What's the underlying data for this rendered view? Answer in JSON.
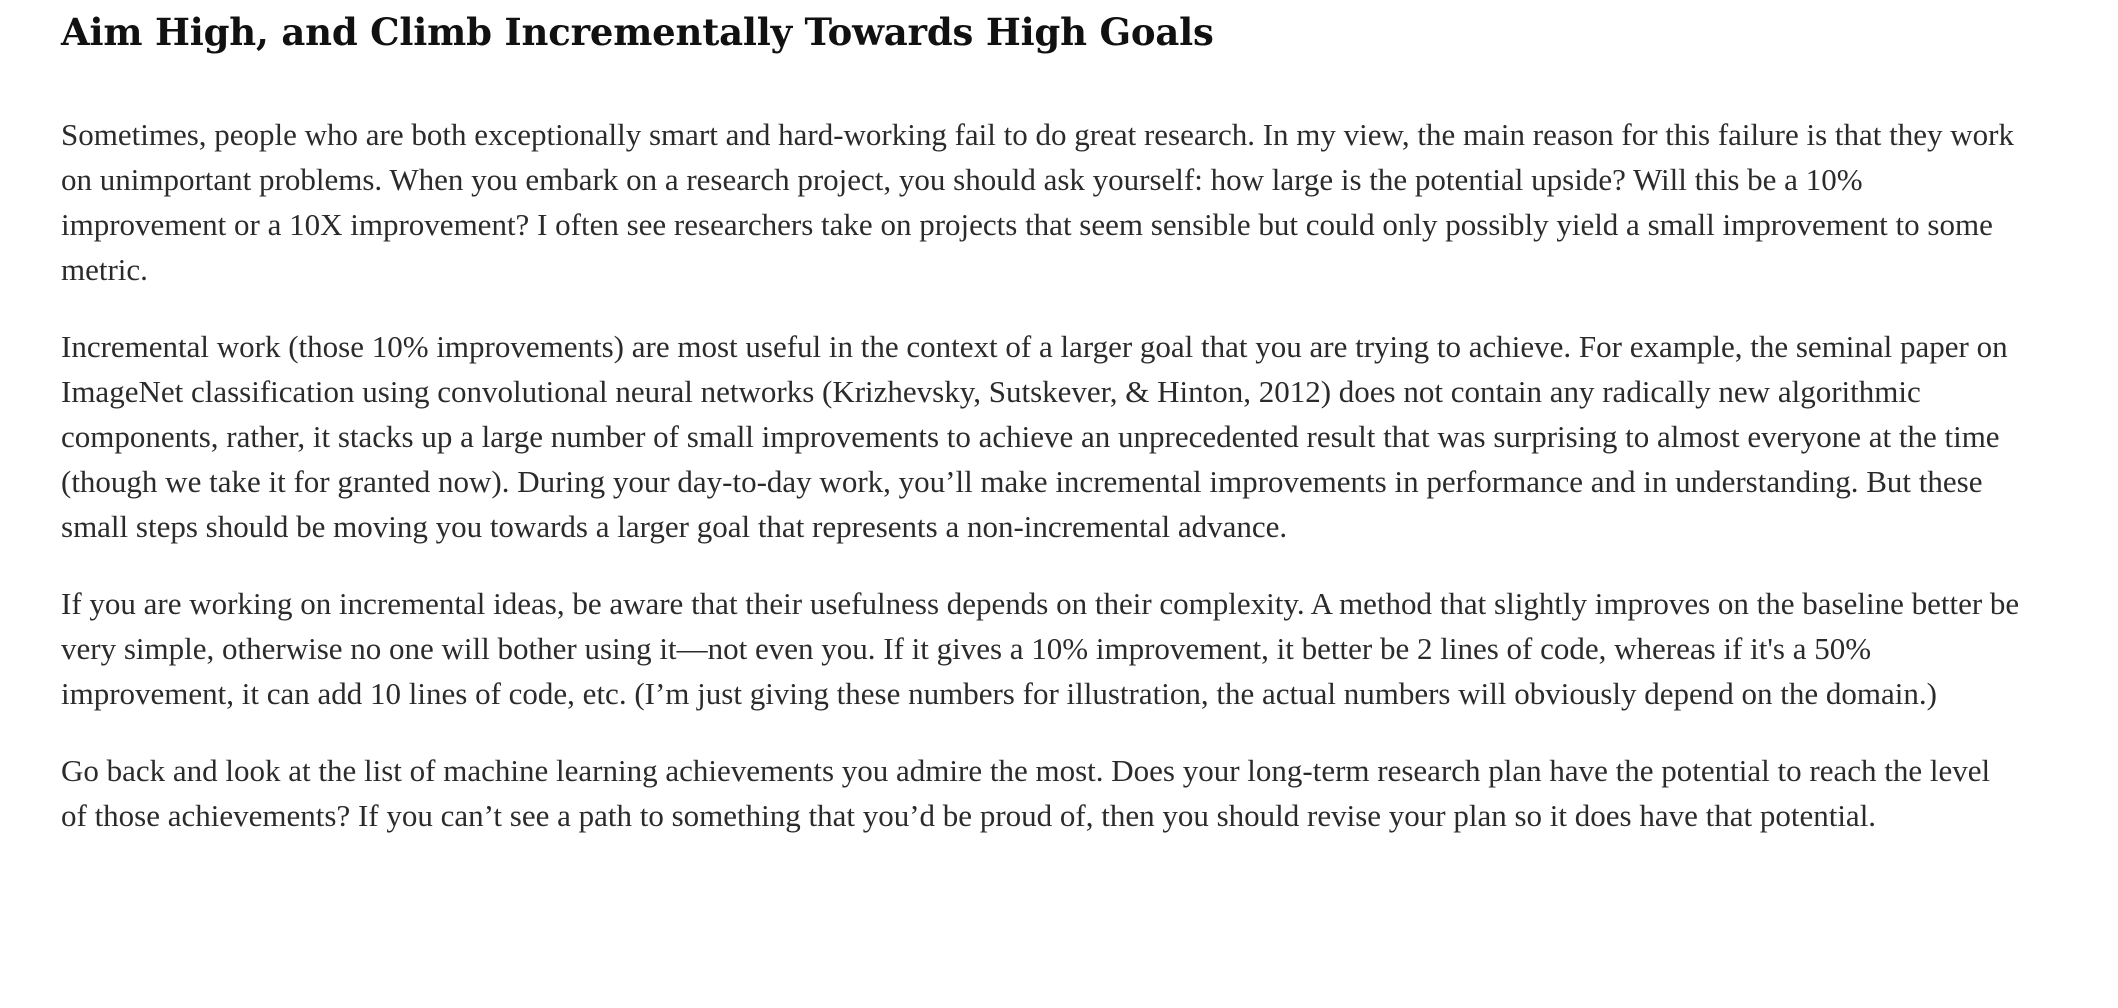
{
  "article": {
    "heading": "Aim High, and Climb Incrementally Towards High Goals",
    "paragraphs": [
      "Sometimes, people who are both exceptionally smart and hard-working fail to do great research. In my view, the main reason for this failure is that they work on unimportant problems. When you embark on a research project, you should ask yourself: how large is the potential upside? Will this be a 10% improvement or a 10X improvement? I often see researchers take on projects that seem sensible but could only possibly yield a small improvement to some metric.",
      "Incremental work (those 10% improvements) are most useful in the context of a larger goal that you are trying to achieve. For example, the seminal paper on ImageNet classification using convolutional neural networks (Krizhevsky, Sutskever, & Hinton, 2012) does not contain any radically new algorithmic components, rather, it stacks up a large number of small improvements to achieve an unprecedented result that was surprising to almost everyone at the time (though we take it for granted now). During your day-to-day work, you’ll make incremental improvements in performance and in understanding. But these small steps should be moving you towards a larger goal that represents a non-incremental advance.",
      "If you are working on incremental ideas, be aware that their usefulness depends on their complexity. A method that slightly improves on the baseline better be very simple, otherwise no one will bother using it—not even you. If it gives a 10% improvement, it better be 2 lines of code, whereas if it's a 50% improvement, it can add 10 lines of code, etc. (I’m just giving these numbers for illustration, the actual numbers will obviously depend on the domain.)",
      "Go back and look at the list of machine learning achievements you admire the most. Does your long-term research plan have the potential to reach the level of those achievements? If you can’t see a path to something that you’d be proud of, then you should revise your plan so it does have that potential."
    ]
  }
}
